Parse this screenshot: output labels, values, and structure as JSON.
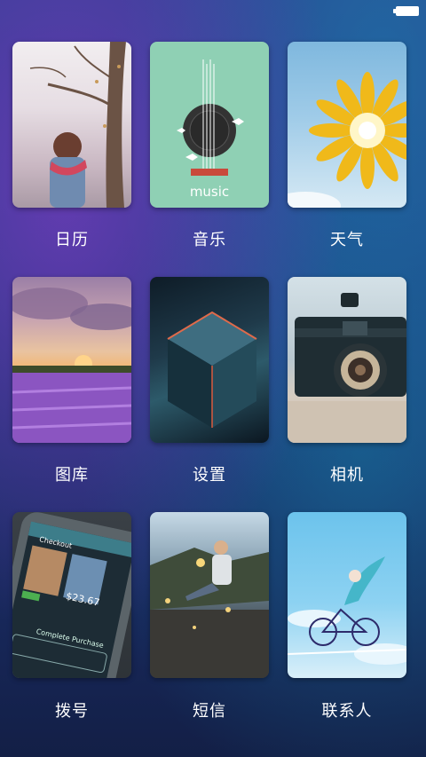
{
  "status_bar": {
    "battery_icon": "battery-icon"
  },
  "apps": [
    {
      "id": "calendar",
      "label": "日历"
    },
    {
      "id": "music",
      "label": "音乐",
      "artwork_text": "music"
    },
    {
      "id": "weather",
      "label": "天气"
    },
    {
      "id": "gallery",
      "label": "图库"
    },
    {
      "id": "settings",
      "label": "设置"
    },
    {
      "id": "camera",
      "label": "相机"
    },
    {
      "id": "dialer",
      "label": "拨号",
      "artwork_text": [
        "Checkout",
        "$23.67",
        "Complete Purchase"
      ]
    },
    {
      "id": "sms",
      "label": "短信"
    },
    {
      "id": "contacts",
      "label": "联系人"
    }
  ]
}
